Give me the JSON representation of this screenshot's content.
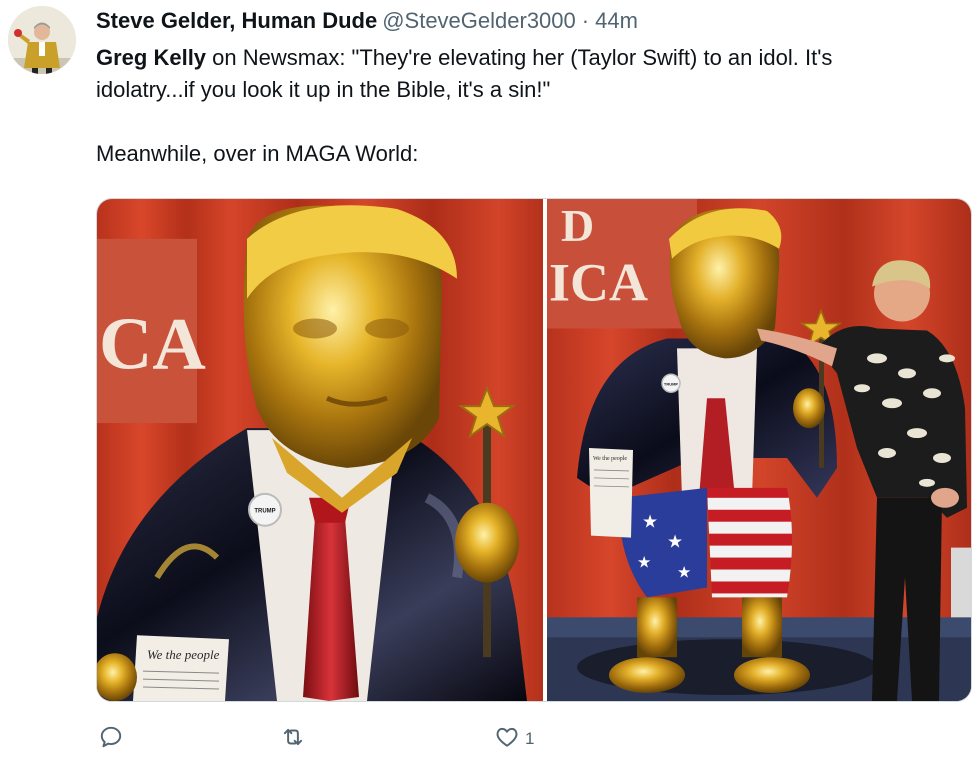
{
  "tweet": {
    "author_name": "Steve Gelder, Human Dude",
    "author_handle": "@SteveGelder3000",
    "separator": "·",
    "timestamp": "44m",
    "text_line1_bold": "Greg Kelly",
    "text_line1_rest": " on Newsmax: \"They're elevating her (Taylor Swift) to an idol. It's",
    "text_line2": "idolatry...if you look it up in the Bible, it's a sin!\"",
    "text_line3": "Meanwhile, over in MAGA World:",
    "photo1": {
      "sign_text": "CA",
      "badge_text": "TRUMP",
      "paper_text": "We the people"
    },
    "photo2": {
      "sign_text_top": "D",
      "sign_text_bottom": "ICA",
      "badge_text": "TRUMP",
      "paper_text": "We the people"
    },
    "actions": {
      "reply_icon": "reply-icon",
      "retweet_icon": "retweet-icon",
      "like_icon": "heart-icon",
      "like_count": "1"
    },
    "colors": {
      "text_primary": "#0f1419",
      "text_secondary": "#536471",
      "border": "#cfd9de"
    }
  }
}
